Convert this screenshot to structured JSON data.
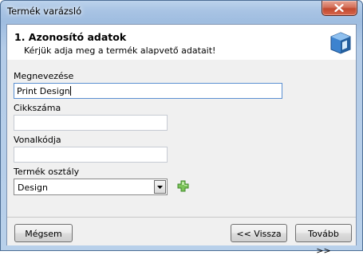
{
  "window": {
    "title": "Termék varázsló"
  },
  "header": {
    "title": "1. Azonosító adatok",
    "subtitle": "Kérjük adja meg a termék alapvető adatait!"
  },
  "form": {
    "name_label": "Megnevezése",
    "name_value": "Print Design",
    "sku_label": "Cikkszáma",
    "sku_value": "",
    "barcode_label": "Vonalkódja",
    "barcode_value": "",
    "class_label": "Termék osztály",
    "class_value": "Design"
  },
  "footer": {
    "cancel_label": "Mégsem",
    "back_label": "<< Vissza",
    "next_label": "Tovább >>"
  },
  "icons": {
    "close": "close-icon",
    "logo": "box-logo-icon",
    "add": "plus-icon",
    "dropdown": "chevron-down-icon"
  },
  "colors": {
    "titlebar": "#a9c4e4",
    "close_button": "#c24a30",
    "focus_border": "#5b8fd1",
    "add_icon": "#6aa84f",
    "logo": "#2e6db3"
  }
}
